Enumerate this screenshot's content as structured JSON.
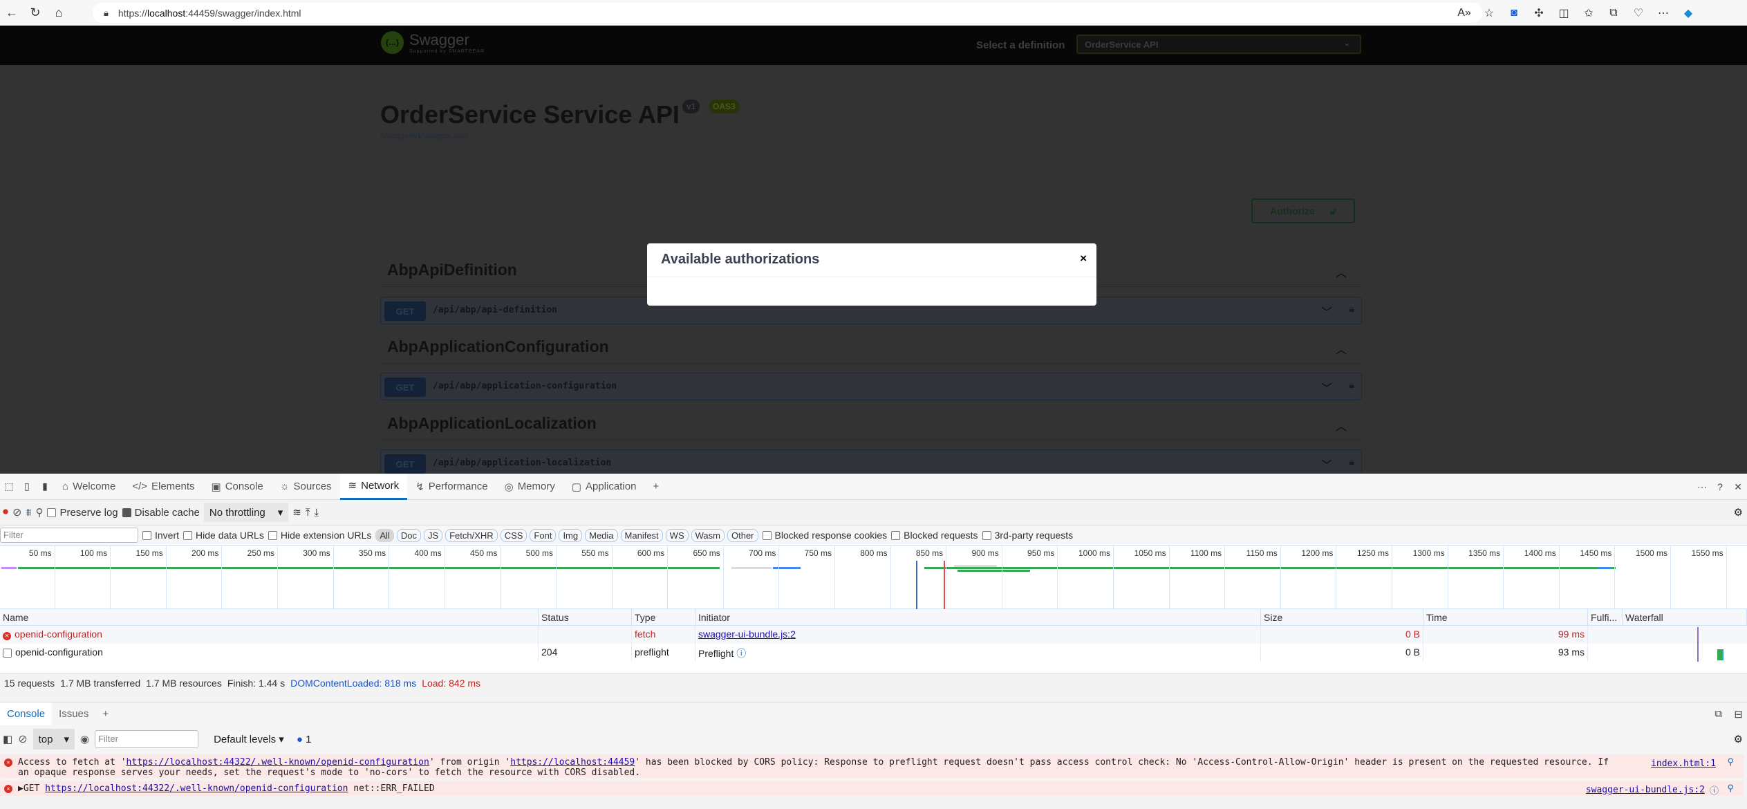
{
  "browser": {
    "url_prefix": "https://",
    "url_host": "localhost",
    "url_rest": ":44459/swagger/index.html",
    "icons": [
      "read-aloud-icon",
      "favorite-star-icon",
      "screen-cast-icon",
      "extensions-icon",
      "split-screen-icon",
      "favorites-icon",
      "collections-icon",
      "browser-health-icon",
      "more-icon"
    ]
  },
  "swagger": {
    "logo_text": "Swagger",
    "logo_sub": "Supported by SMARTBEAR",
    "definition_label": "Select a definition",
    "definition_value": "OrderService API",
    "title": "OrderService Service API",
    "version_badge": "v1",
    "oas_badge": "OAS3",
    "spec_link": "/swagger/v1/swagger.json",
    "authorize_label": "Authorize",
    "tags": [
      {
        "name": "AbpApiDefinition",
        "method": "GET",
        "path": "/api/abp/api-definition"
      },
      {
        "name": "AbpApplicationConfiguration",
        "method": "GET",
        "path": "/api/abp/application-configuration"
      },
      {
        "name": "AbpApplicationLocalization",
        "method": "GET",
        "path": "/api/abp/application-localization"
      }
    ],
    "modal": {
      "title": "Available authorizations",
      "close": "×"
    }
  },
  "devtools": {
    "tabs": [
      {
        "label": "Welcome",
        "icon": "⌂"
      },
      {
        "label": "Elements",
        "icon": "</>"
      },
      {
        "label": "Console",
        "icon": "▣"
      },
      {
        "label": "Sources",
        "icon": "⚙"
      },
      {
        "label": "Network",
        "icon": "≋"
      },
      {
        "label": "Performance",
        "icon": "↯"
      },
      {
        "label": "Memory",
        "icon": "◎"
      },
      {
        "label": "Application",
        "icon": "▢"
      }
    ],
    "active_tab": "Network",
    "network": {
      "preserve_log": "Preserve log",
      "preserve_log_checked": false,
      "disable_cache": "Disable cache",
      "disable_cache_checked": true,
      "throttling": "No throttling",
      "filter_placeholder": "Filter",
      "invert": "Invert",
      "hide_data_urls": "Hide data URLs",
      "hide_extension_urls": "Hide extension URLs",
      "type_filters": [
        "All",
        "Doc",
        "JS",
        "Fetch/XHR",
        "CSS",
        "Font",
        "Img",
        "Media",
        "Manifest",
        "WS",
        "Wasm",
        "Other"
      ],
      "active_type_filter": "All",
      "blocked_response_cookies": "Blocked response cookies",
      "blocked_requests": "Blocked requests",
      "third_party": "3rd-party requests",
      "timeline_ticks": [
        "50 ms",
        "100 ms",
        "150 ms",
        "200 ms",
        "250 ms",
        "300 ms",
        "350 ms",
        "400 ms",
        "450 ms",
        "500 ms",
        "550 ms",
        "600 ms",
        "650 ms",
        "700 ms",
        "750 ms",
        "800 ms",
        "850 ms",
        "900 ms",
        "950 ms",
        "1000 ms",
        "1050 ms",
        "1100 ms",
        "1150 ms",
        "1200 ms",
        "1250 ms",
        "1300 ms",
        "1350 ms",
        "1400 ms",
        "1450 ms",
        "1500 ms",
        "1550 ms"
      ],
      "columns": [
        "Name",
        "Status",
        "Type",
        "Initiator",
        "Size",
        "Time",
        "Fulfi...",
        "Waterfall"
      ],
      "rows": [
        {
          "name": "openid-configuration",
          "status": "",
          "type": "fetch",
          "initiator": "swagger-ui-bundle.js:2",
          "size": "0 B",
          "time": "99 ms",
          "error": true
        },
        {
          "name": "openid-configuration",
          "status": "204",
          "type": "preflight",
          "initiator": "Preflight",
          "size": "0 B",
          "time": "93 ms",
          "error": false
        }
      ],
      "summary": {
        "requests": "15 requests",
        "transferred": "1.7 MB transferred",
        "resources": "1.7 MB resources",
        "finish": "Finish: 1.44 s",
        "dcl": "DOMContentLoaded: 818 ms",
        "load": "Load: 842 ms"
      }
    },
    "drawer": {
      "tabs": [
        "Console",
        "Issues"
      ],
      "context": "top",
      "filter_placeholder": "Filter",
      "levels": "Default levels",
      "issues_count": "1",
      "messages": [
        {
          "text_1": "Access to fetch at '",
          "url_1": "https://localhost:44322/.well-known/openid-configuration",
          "text_2": "' from origin '",
          "url_2": "https://localhost:44459",
          "text_3": "' has been blocked by CORS policy: Response to preflight request doesn't pass access control check: No 'Access-Control-Allow-Origin' header is present on the requested resource. If an opaque response serves your needs, set the request's mode to 'no-cors' to fetch the resource with CORS disabled.",
          "source": "index.html:1"
        },
        {
          "prefix": "▶GET ",
          "url": "https://localhost:44322/.well-known/openid-configuration",
          "suffix": " net::ERR_FAILED",
          "source": "swagger-ui-bundle.js:2"
        }
      ]
    }
  },
  "colors": {
    "accent": "#0f6cbd",
    "error": "#c5221f",
    "swagger_green": "#49cc90",
    "get_blue": "#61affe"
  }
}
